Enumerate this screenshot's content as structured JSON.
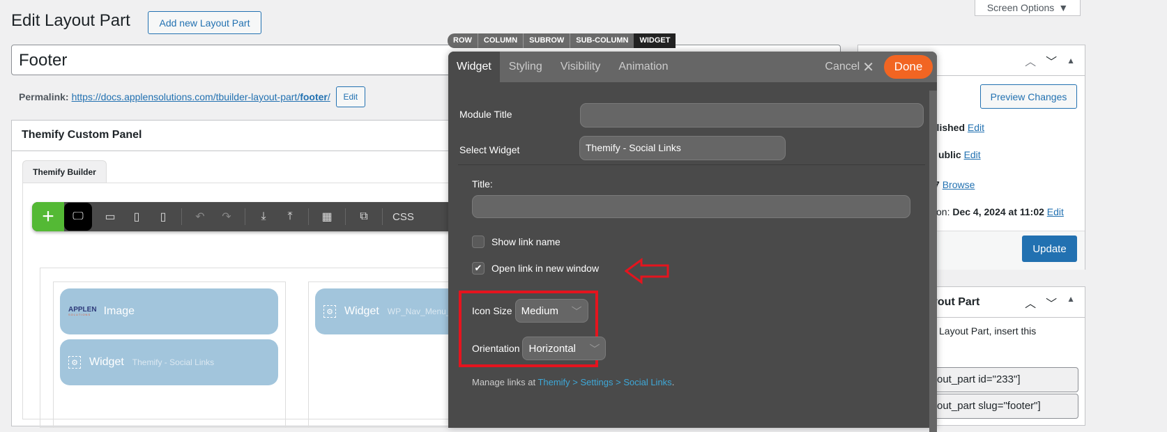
{
  "header": {
    "title": "Edit Layout Part",
    "add_new": "Add new Layout Part",
    "screen_options": "Screen Options"
  },
  "post": {
    "title": "Footer",
    "permalink_label": "Permalink:",
    "permalink_base": "https://docs.applensolutions.com/tbuilder-layout-part/",
    "permalink_slug": "footer",
    "permalink_end": "/",
    "edit": "Edit"
  },
  "panel": {
    "title": "Themify Custom Panel",
    "tab": "Themify Builder"
  },
  "toolbar": {
    "css": "CSS"
  },
  "modules": [
    {
      "type": "Image",
      "sub": "",
      "logo": "APPLEN",
      "logo_sub": "SOLUTIONS"
    },
    {
      "type": "Widget",
      "sub": "Themify - Social Links"
    },
    {
      "type": "Widget",
      "sub": "WP_Nav_Menu_"
    }
  ],
  "breadcrumb": [
    "ROW",
    "COLUMN",
    "SUBROW",
    "SUB-COLUMN",
    "WIDGET"
  ],
  "dialog": {
    "tabs": [
      "Widget",
      "Styling",
      "Visibility",
      "Animation"
    ],
    "cancel": "Cancel",
    "done": "Done",
    "module_title_label": "Module Title",
    "module_title_value": "",
    "select_widget_label": "Select Widget",
    "select_widget_value": "Themify - Social Links",
    "title_label": "Title:",
    "title_value": "",
    "show_link_name": "Show link name",
    "show_link_name_checked": false,
    "open_new_window": "Open link in new window",
    "open_new_window_checked": true,
    "icon_size_label": "Icon Size",
    "icon_size_value": "Medium",
    "orientation_label": "Orientation",
    "orientation_value": "Horizontal",
    "manage_prefix": "Manage links at ",
    "manage_link1": "Themify",
    "manage_link2": "Settings",
    "manage_link3": "Social Links",
    "manage_sep": " > ",
    "manage_end": "."
  },
  "publish": {
    "preview": "Preview Changes",
    "status": "blished",
    "visibility": "ublic",
    "revisions": "7",
    "browse": "Browse",
    "date_prefix": "on: ",
    "date": "Dec 4, 2024 at 11:02",
    "edit": "Edit",
    "update": "Update"
  },
  "shortcode_box": {
    "title": "yout Part",
    "text": "Layout Part, insert this",
    "code1": "out_part id=\"233\"]",
    "code2": "out_part slug=\"footer\"]"
  },
  "colors": {
    "accent": "#2271b1",
    "done": "#f26522",
    "builder_green": "#54b935",
    "annotation": "#e5141e"
  }
}
